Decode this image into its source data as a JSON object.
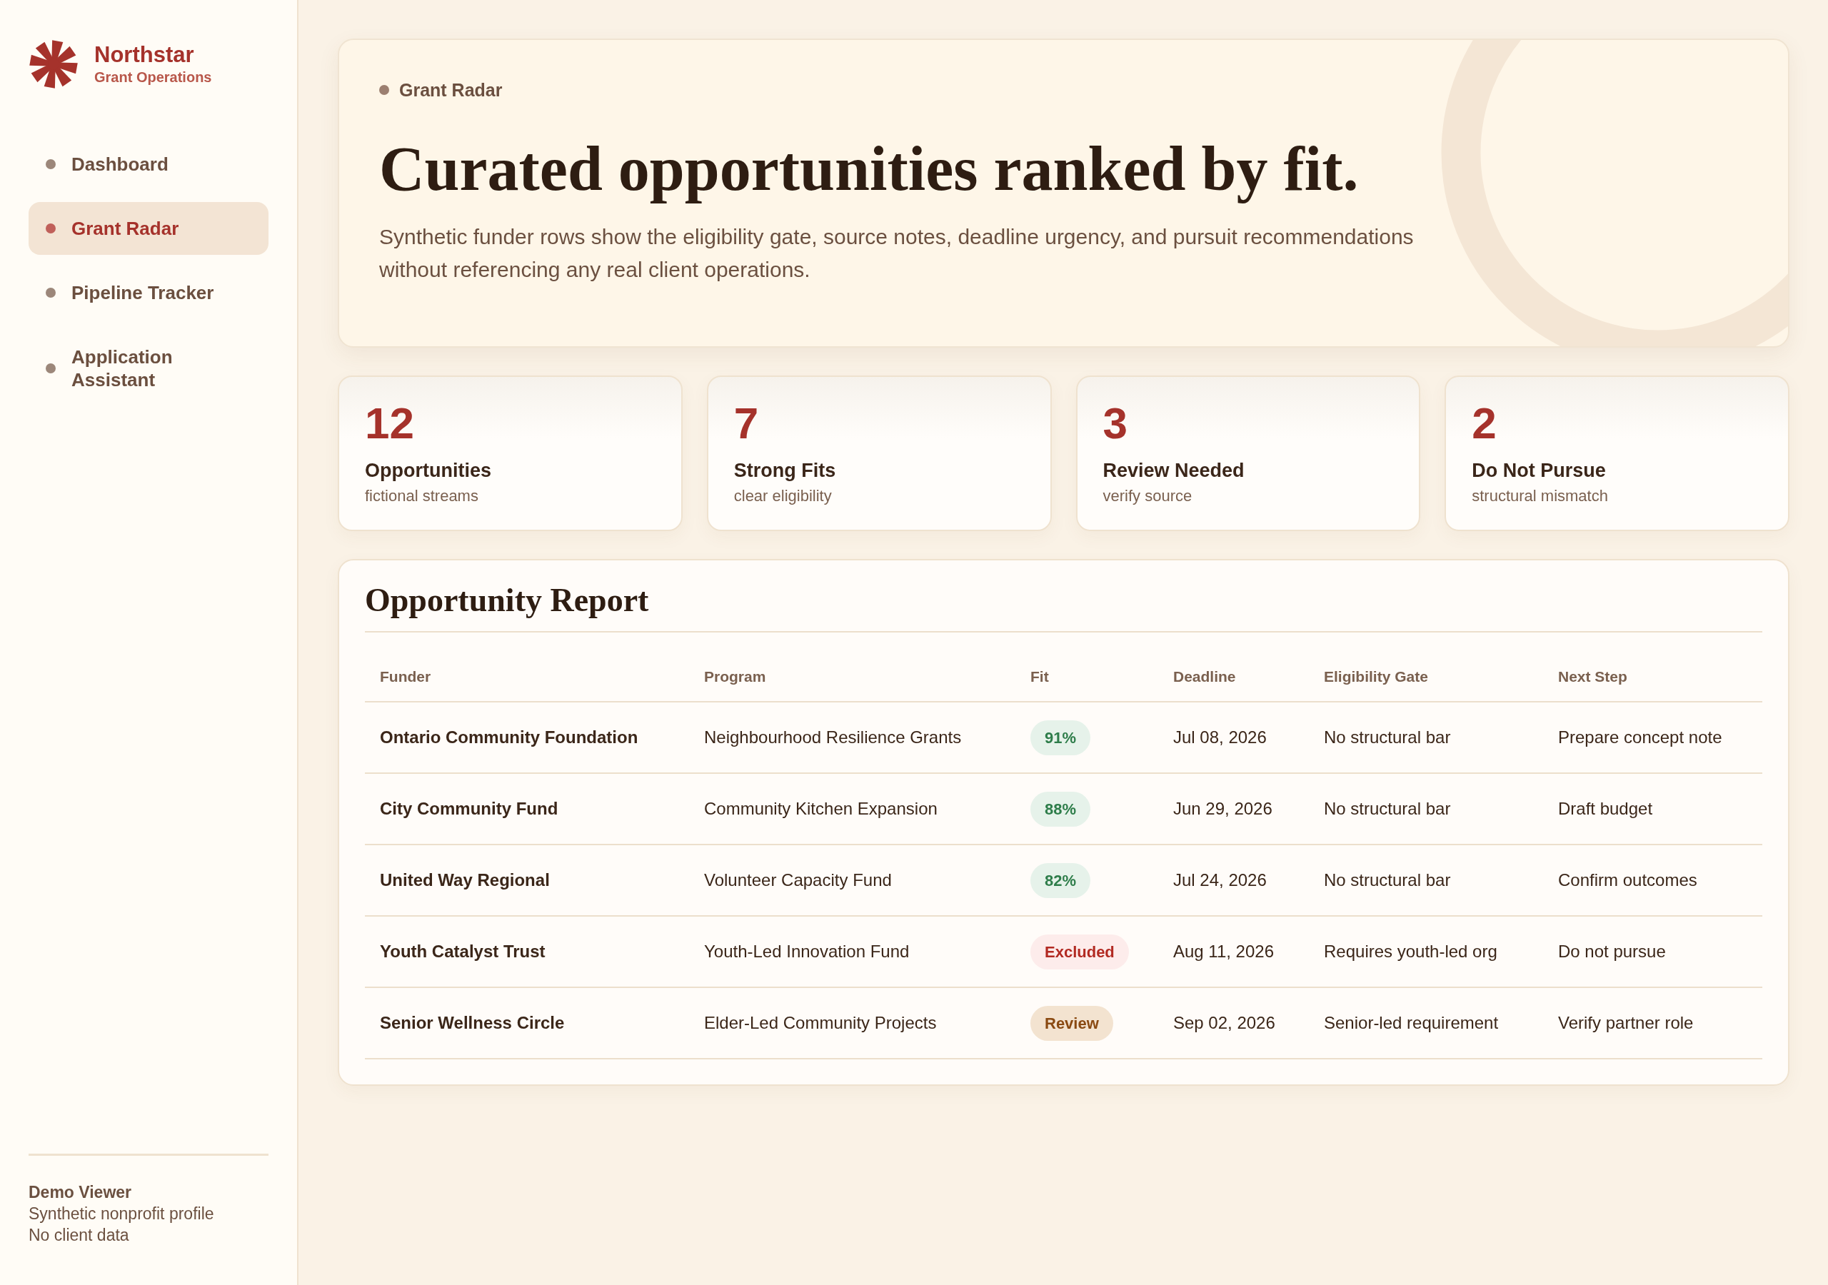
{
  "brand": {
    "name": "Northstar",
    "tagline": "Grant Operations"
  },
  "sidebar": {
    "items": [
      {
        "label": "Dashboard",
        "selected": false
      },
      {
        "label": "Grant Radar",
        "selected": true
      },
      {
        "label": "Pipeline Tracker",
        "selected": false
      },
      {
        "label": "Application Assistant",
        "selected": false
      }
    ]
  },
  "profile": {
    "name": "Demo Viewer",
    "details": [
      "Synthetic nonprofit profile",
      "No client data"
    ]
  },
  "hero": {
    "eyebrow": "Grant Radar",
    "title": "Curated opportunities ranked by fit.",
    "description": "Synthetic funder rows show the eligibility gate, source notes, deadline urgency, and pursuit recommendations without referencing any real client operations."
  },
  "stats": [
    {
      "value": "12",
      "label": "Opportunities",
      "note": "fictional streams"
    },
    {
      "value": "7",
      "label": "Strong Fits",
      "note": "clear eligibility"
    },
    {
      "value": "3",
      "label": "Review Needed",
      "note": "verify source"
    },
    {
      "value": "2",
      "label": "Do Not Pursue",
      "note": "structural mismatch"
    }
  ],
  "report": {
    "title": "Opportunity Report",
    "columns": [
      "Funder",
      "Program",
      "Fit",
      "Deadline",
      "Eligibility Gate",
      "Next Step"
    ],
    "rows": [
      {
        "funder": "Ontario Community Foundation",
        "program": "Neighbourhood Resilience Grants",
        "fit": {
          "label": "91%",
          "kind": "match"
        },
        "deadline": "Jul 08, 2026",
        "eligibility_gate": "No structural bar",
        "next_step": "Prepare concept note"
      },
      {
        "funder": "City Community Fund",
        "program": "Community Kitchen Expansion",
        "fit": {
          "label": "88%",
          "kind": "match"
        },
        "deadline": "Jun 29, 2026",
        "eligibility_gate": "No structural bar",
        "next_step": "Draft budget"
      },
      {
        "funder": "United Way Regional",
        "program": "Volunteer Capacity Fund",
        "fit": {
          "label": "82%",
          "kind": "match"
        },
        "deadline": "Jul 24, 2026",
        "eligibility_gate": "No structural bar",
        "next_step": "Confirm outcomes"
      },
      {
        "funder": "Youth Catalyst Trust",
        "program": "Youth-Led Innovation Fund",
        "fit": {
          "label": "Excluded",
          "kind": "excluded"
        },
        "deadline": "Aug 11, 2026",
        "eligibility_gate": "Requires youth-led org",
        "next_step": "Do not pursue"
      },
      {
        "funder": "Senior Wellness Circle",
        "program": "Elder-Led Community Projects",
        "fit": {
          "label": "Review",
          "kind": "review"
        },
        "deadline": "Sep 02, 2026",
        "eligibility_gate": "Senior-led requirement",
        "next_step": "Verify partner role"
      }
    ]
  }
}
